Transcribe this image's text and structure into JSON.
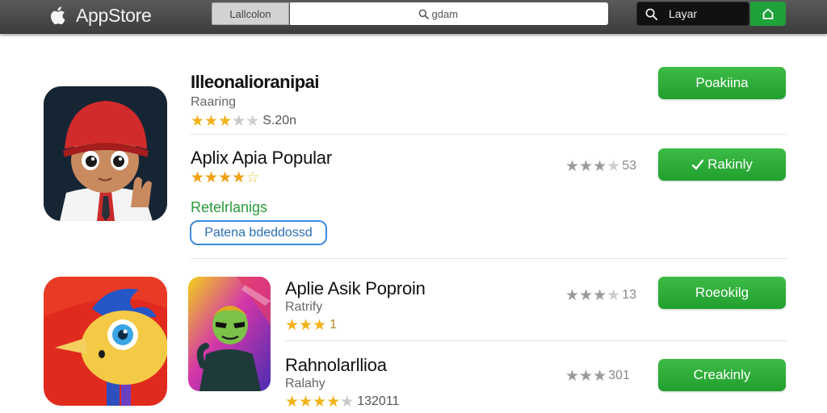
{
  "header": {
    "brand_icon": "apple-icon",
    "brand": "AppStore",
    "location_tab": "Lallcolon",
    "search": {
      "icon": "search-icon",
      "value": "gdam"
    },
    "layer_button": {
      "icon": "search-icon",
      "label": "Layar"
    },
    "home_button": {
      "icon": "home-icon"
    },
    "colors": {
      "bar": "#4a4a4a",
      "accent": "#1fa23a"
    }
  },
  "apps": [
    {
      "title": "Illeonalioranipai",
      "subtitle": "Raaring",
      "stars": 3,
      "rating_text": "S.20n",
      "cta": "Poakiina",
      "icon": "red-hat-character-icon"
    },
    {
      "title": "Aplix Apia Popular",
      "stars": 4,
      "status": "Retelrlanigs",
      "outline_button": "Patena bdeddossd",
      "right_rating": "53",
      "cta": "Rakinly",
      "cta_icon": "checkmark-icon"
    },
    {
      "title": "Aplie Asik Poproin",
      "subtitle": "Ratrify",
      "stars": 3,
      "rating_text": "1",
      "right_rating": "13",
      "cta": "Roeokilg",
      "icon": "green-hero-icon",
      "side_icon": "blue-bird-icon"
    },
    {
      "title": "Rahnolarllioa",
      "subtitle": "Ralahy",
      "stars": 4,
      "rating_text": "132011",
      "right_rating": "301",
      "cta": "Creakinly"
    }
  ],
  "colors": {
    "cta_green": "#27a834",
    "star_gold": "#f2b21a",
    "link_blue": "#3d8be0"
  }
}
